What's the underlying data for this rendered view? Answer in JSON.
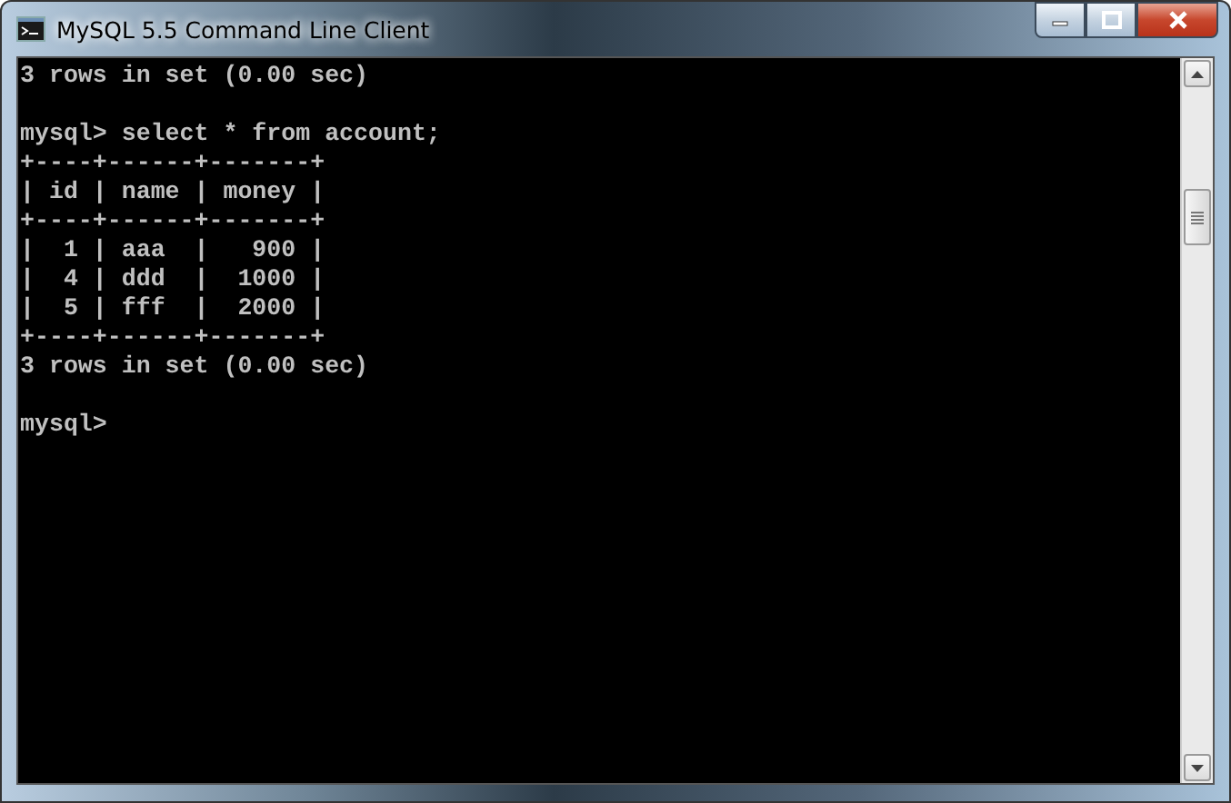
{
  "window": {
    "title": "MySQL 5.5 Command Line Client"
  },
  "console": {
    "blocks": [
      [
        "3 rows in set (0.00 sec)"
      ],
      [
        "mysql> select * from account;",
        "+----+------+-------+",
        "| id | name | money |",
        "+----+------+-------+",
        "|  1 | aaa  |   900 |",
        "|  4 | ddd  |  1000 |",
        "|  5 | fff  |  2000 |",
        "+----+------+-------+",
        "3 rows in set (0.00 sec)"
      ],
      [
        "mysql>"
      ]
    ]
  }
}
